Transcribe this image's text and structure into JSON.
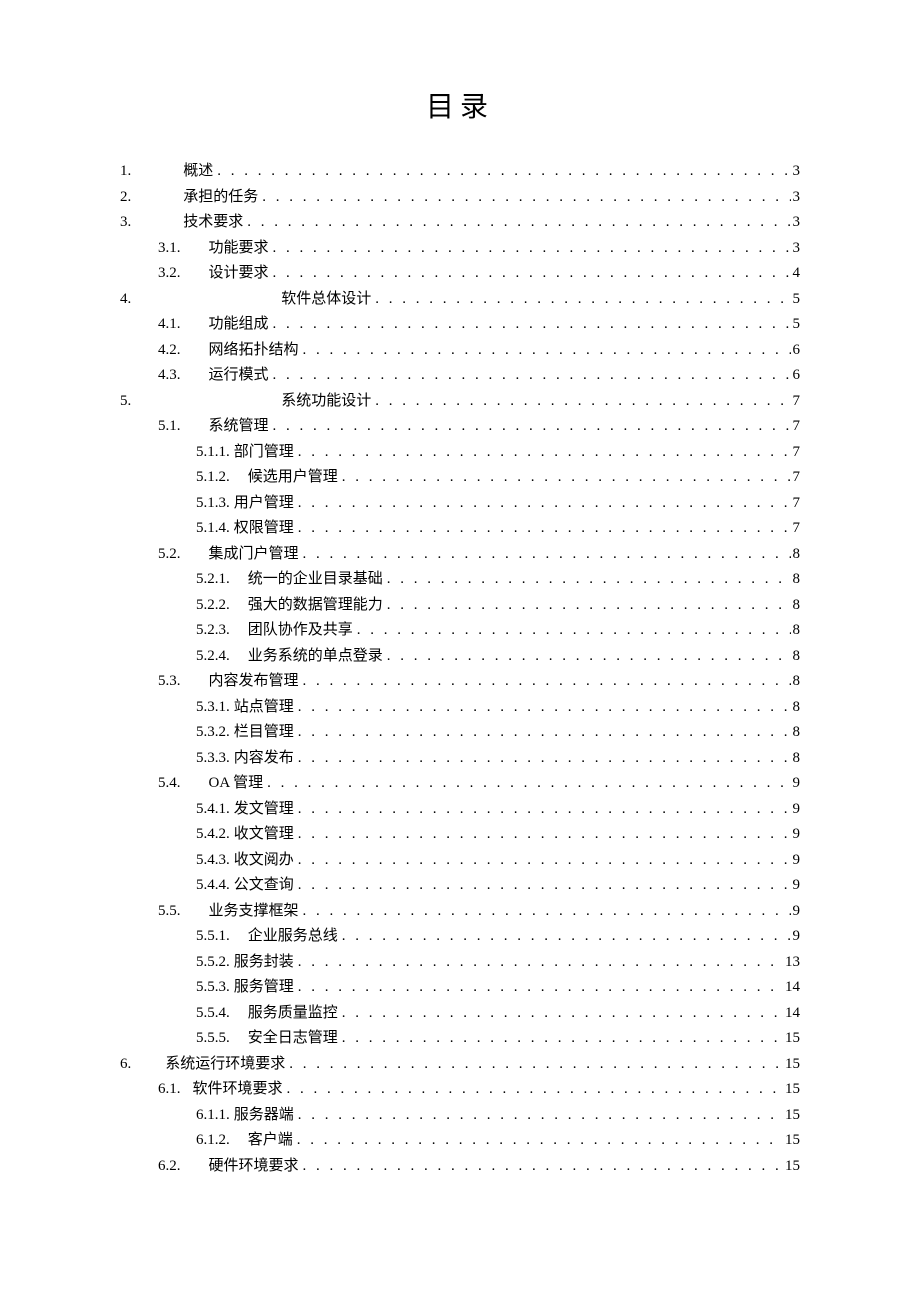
{
  "title": "目录",
  "entries": [
    {
      "level": 0,
      "num": "1.",
      "gap": 52,
      "label": "概述",
      "page": "3"
    },
    {
      "level": 0,
      "num": "2.",
      "gap": 52,
      "label": "承担的任务",
      "page": "3"
    },
    {
      "level": 0,
      "num": "3.",
      "gap": 52,
      "label": "技术要求",
      "page": "3"
    },
    {
      "level": 1,
      "num": "3.1.",
      "gap": 28,
      "label": "功能要求",
      "page": "3"
    },
    {
      "level": 1,
      "num": "3.2.",
      "gap": 28,
      "label": "设计要求",
      "page": "4"
    },
    {
      "level": 0,
      "num": "4.",
      "gap": 150,
      "label": "软件总体设计",
      "page": "5"
    },
    {
      "level": 1,
      "num": "4.1.",
      "gap": 28,
      "label": "功能组成",
      "page": " 5"
    },
    {
      "level": 1,
      "num": "4.2.",
      "gap": 28,
      "label": "网络拓扑结构",
      "page": "6"
    },
    {
      "level": 1,
      "num": "4.3.",
      "gap": 28,
      "label": "运行模式",
      "page": "6"
    },
    {
      "level": 0,
      "num": "5.",
      "gap": 150,
      "label": "系统功能设计",
      "page": "7"
    },
    {
      "level": 1,
      "num": "5.1.",
      "gap": 28,
      "label": "系统管理",
      "page": "7"
    },
    {
      "level": 2,
      "num": "5.1.1.",
      "gap": 4,
      "label": "部门管理",
      "page": "7"
    },
    {
      "level": 2,
      "num": "5.1.2.",
      "gap": 18,
      "label": "候选用户管理",
      "page": "7"
    },
    {
      "level": 2,
      "num": "5.1.3.",
      "gap": 4,
      "label": "用户管理",
      "page": "7"
    },
    {
      "level": 2,
      "num": "5.1.4.",
      "gap": 4,
      "label": "权限管理",
      "page": "7"
    },
    {
      "level": 1,
      "num": "5.2.",
      "gap": 28,
      "label": "集成门户管理",
      "page": "8"
    },
    {
      "level": 2,
      "num": "5.2.1.",
      "gap": 18,
      "label": "统一的企业目录基础",
      "page": "8"
    },
    {
      "level": 2,
      "num": "5.2.2.",
      "gap": 18,
      "label": "强大的数据管理能力",
      "page": "8"
    },
    {
      "level": 2,
      "num": "5.2.3.",
      "gap": 18,
      "label": "团队协作及共享",
      "page": "8"
    },
    {
      "level": 2,
      "num": "5.2.4.",
      "gap": 18,
      "label": "业务系统的单点登录",
      "page": "8"
    },
    {
      "level": 1,
      "num": "5.3.",
      "gap": 28,
      "label": "内容发布管理",
      "page": "8"
    },
    {
      "level": 2,
      "num": "5.3.1.",
      "gap": 4,
      "label": "站点管理",
      "page": "8"
    },
    {
      "level": 2,
      "num": "5.3.2.",
      "gap": 4,
      "label": "栏目管理",
      "page": "8"
    },
    {
      "level": 2,
      "num": "5.3.3.",
      "gap": 4,
      "label": "内容发布",
      "page": "8"
    },
    {
      "level": 1,
      "num": "5.4.",
      "gap": 28,
      "label": "OA 管理",
      "page": "9"
    },
    {
      "level": 2,
      "num": "5.4.1.",
      "gap": 4,
      "label": "发文管理",
      "page": "9"
    },
    {
      "level": 2,
      "num": "5.4.2.",
      "gap": 4,
      "label": "收文管理",
      "page": "9"
    },
    {
      "level": 2,
      "num": "5.4.3.",
      "gap": 4,
      "label": "收文阅办",
      "page": "9"
    },
    {
      "level": 2,
      "num": "5.4.4.",
      "gap": 4,
      "label": "公文查询",
      "page": "9"
    },
    {
      "level": 1,
      "num": "5.5.",
      "gap": 28,
      "label": "业务支撑框架",
      "page": "9"
    },
    {
      "level": 2,
      "num": "5.5.1.",
      "gap": 18,
      "label": "企业服务总线",
      "page": "9"
    },
    {
      "level": 2,
      "num": "5.5.2.",
      "gap": 4,
      "label": "服务封装",
      "page": "13"
    },
    {
      "level": 2,
      "num": "5.5.3.",
      "gap": 4,
      "label": "服务管理",
      "page": "14"
    },
    {
      "level": 2,
      "num": "5.5.4.",
      "gap": 18,
      "label": "服务质量监控",
      "page": "14"
    },
    {
      "level": 2,
      "num": "5.5.5.",
      "gap": 18,
      "label": "安全日志管理",
      "page": "15"
    },
    {
      "level": 0,
      "num": "6.",
      "gap": 34,
      "label": "系统运行环境要求",
      "page": "15"
    },
    {
      "level": 1,
      "num": "6.1.",
      "gap": 12,
      "label": "软件环境要求",
      "page": "15"
    },
    {
      "level": 2,
      "num": "6.1.1.",
      "gap": 4,
      "label": "服务器端",
      "page": "15"
    },
    {
      "level": 2,
      "num": "6.1.2.",
      "gap": 18,
      "label": "客户端",
      "page": "15"
    },
    {
      "level": 1,
      "num": "6.2.",
      "gap": 28,
      "label": "硬件环境要求",
      "page": "15"
    }
  ]
}
